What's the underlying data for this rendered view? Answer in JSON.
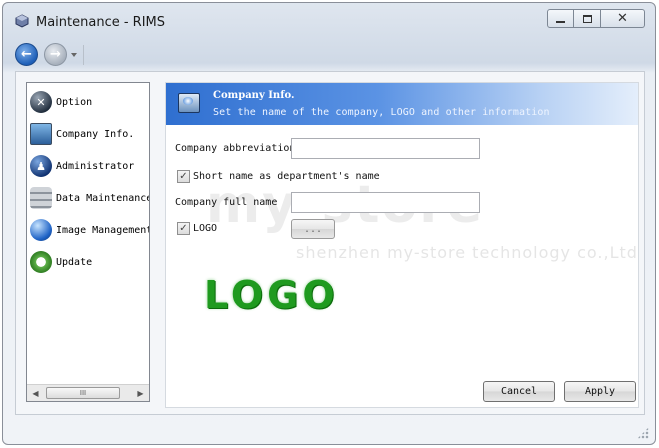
{
  "window": {
    "title": "Maintenance - RIMS",
    "controls": {
      "minimize": "",
      "maximize": "",
      "close": "✕"
    }
  },
  "nav": {
    "back_glyph": "←",
    "forward_glyph": "→"
  },
  "sidebar": {
    "items": [
      {
        "label": "Option",
        "icon": "wrench-icon"
      },
      {
        "label": "Company Info.",
        "icon": "monitor-icon"
      },
      {
        "label": "Administrator",
        "icon": "user-icon"
      },
      {
        "label": "Data Maintenance",
        "icon": "database-icon"
      },
      {
        "label": "Image Management",
        "icon": "globe-icon"
      },
      {
        "label": "Update",
        "icon": "gear-icon"
      }
    ],
    "scroll_thumb_glyph": "III"
  },
  "panel": {
    "banner": {
      "title": "Company Info.",
      "subtitle": "Set the name of the company, LOGO and other information"
    },
    "fields": {
      "abbreviation_label": "Company abbreviation",
      "abbreviation_value": "",
      "short_as_dept_label": "Short name as department's name",
      "short_as_dept_checked": true,
      "full_name_label": "Company full name",
      "full_name_value": "",
      "logo_label": "LOGO",
      "logo_checked": true,
      "browse_button": "..."
    },
    "logo_text": "LOGO",
    "buttons": {
      "cancel": "Cancel",
      "apply": "Apply"
    }
  },
  "watermark": {
    "main": "my-store",
    "sub": "shenzhen my-store technology co.,Ltd"
  },
  "colors": {
    "banner": "#2f6fd0",
    "logo_green": "#1f9a1f"
  }
}
